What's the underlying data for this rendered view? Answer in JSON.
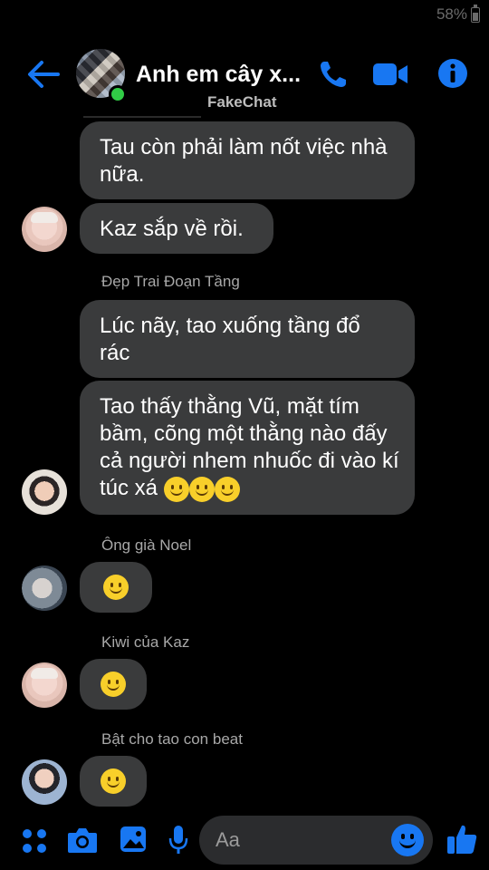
{
  "status": {
    "battery": "58%"
  },
  "header": {
    "title": "Anh em cây x...",
    "watermark": "FakeChat"
  },
  "messages": [
    {
      "text": "Tau còn phải làm nốt việc nhà nữa."
    },
    {
      "text": "Kaz sắp về rồi."
    },
    {
      "sender": "Đẹp Trai Đoạn Tầng"
    },
    {
      "text": "Lúc nãy, tao xuống tầng đổ rác"
    },
    {
      "text": "Tao thấy thằng Vũ, mặt tím bầm, cõng một thằng nào đấy cả người nhem nhuốc đi vào kí túc xá"
    },
    {
      "sender": "Ông già Noel"
    },
    {
      "sender": "Kiwi của Kaz"
    },
    {
      "sender": "Bật cho tao con beat"
    }
  ],
  "composer": {
    "placeholder": "Aa"
  },
  "icons": {
    "back": "back-arrow-icon",
    "call": "phone-icon",
    "video": "video-camera-icon",
    "info": "info-icon",
    "apps": "apps-grid-icon",
    "camera": "camera-icon",
    "gallery": "image-icon",
    "mic": "microphone-icon",
    "emoji": "smiley-emoji-icon",
    "like": "thumbs-up-icon"
  },
  "colors": {
    "accent": "#1877f2",
    "bubble": "#3a3b3c",
    "online": "#31cc46",
    "background": "#000000"
  }
}
